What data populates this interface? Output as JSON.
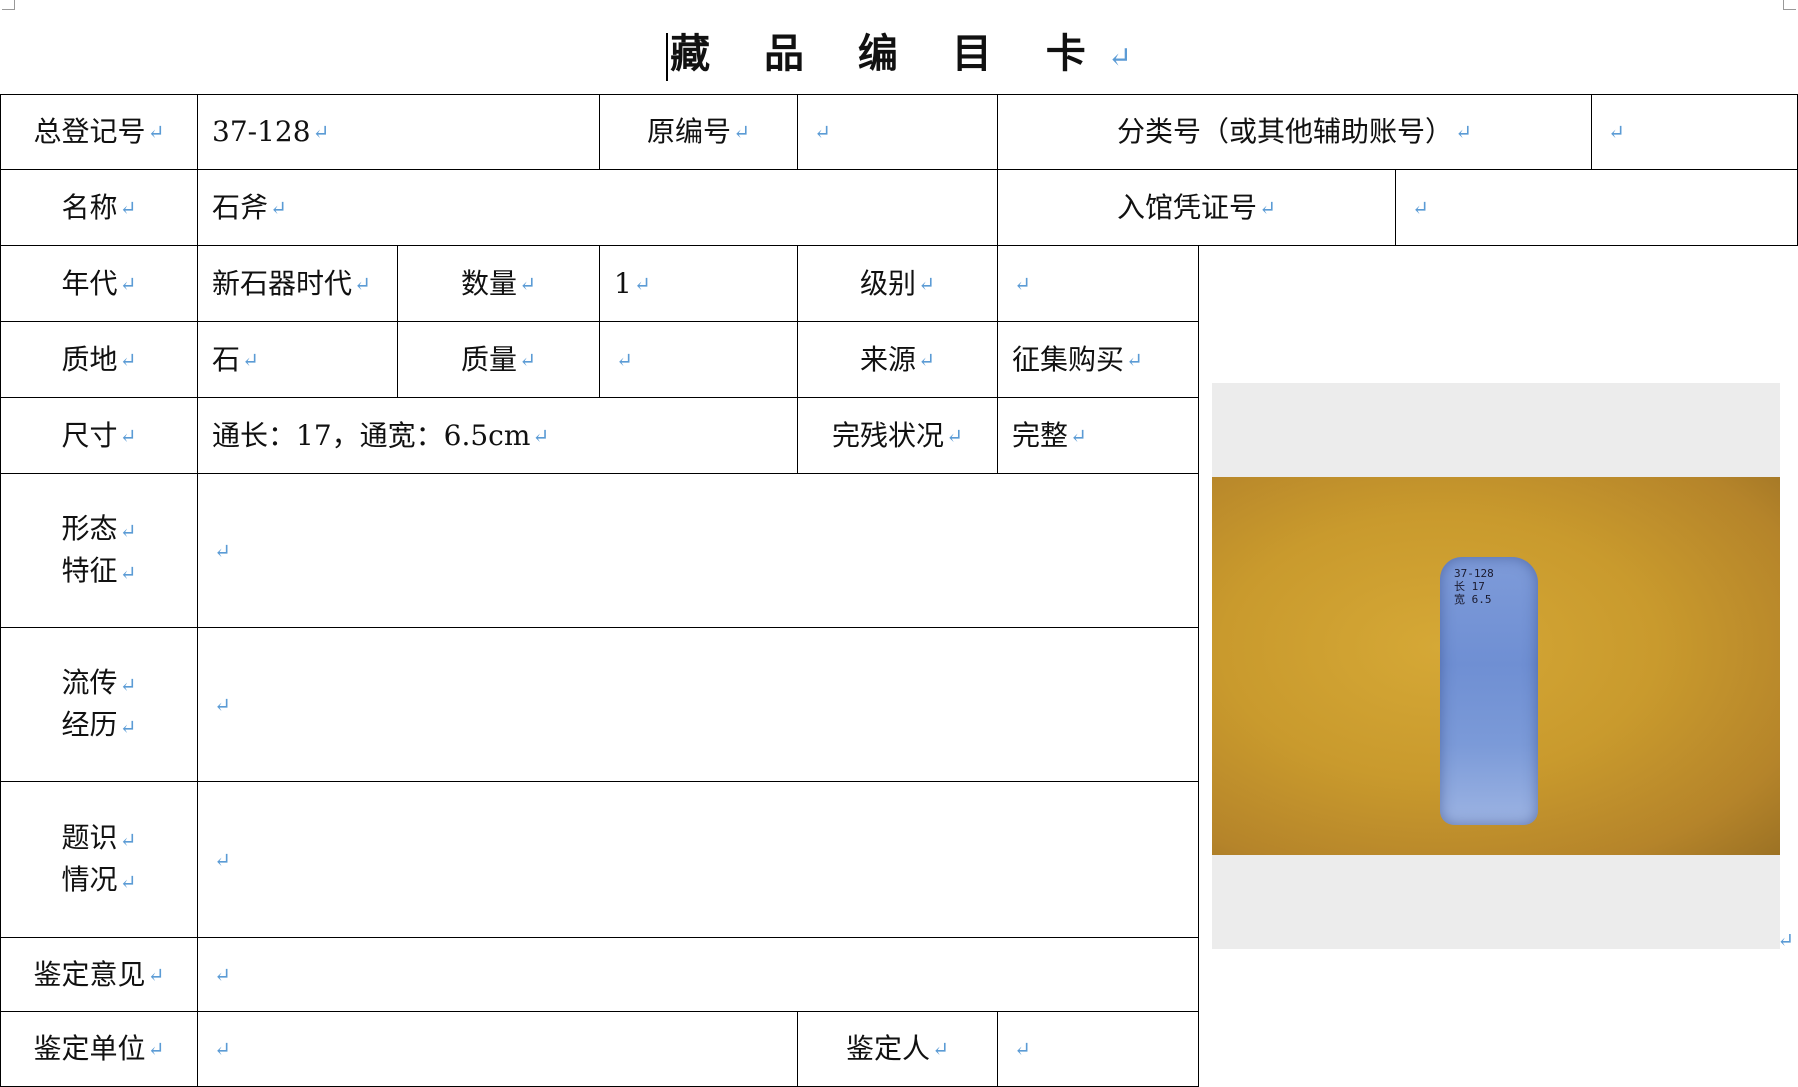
{
  "title": "藏 品 编 目 卡",
  "return_mark": "↵",
  "row1": {
    "label1": "总登记号",
    "value1": "37-128",
    "label2": "原编号",
    "value2": "",
    "label3": "分类号（或其他辅助账号）",
    "value3": ""
  },
  "row2": {
    "label1": "名称",
    "value1": "石斧",
    "label2": "入馆凭证号",
    "value2": ""
  },
  "row3": {
    "label1": "年代",
    "value1": "新石器时代",
    "label2": "数量",
    "value2": "1",
    "label3": "级别",
    "value3": ""
  },
  "row4": {
    "label1": "质地",
    "value1": "石",
    "label2": "质量",
    "value2": "",
    "label3": "来源",
    "value3": "征集购买"
  },
  "row5": {
    "label1": "尺寸",
    "value1": "通长：17，通宽：6.5cm",
    "label2": "完残状况",
    "value2": "完整"
  },
  "row6": {
    "label_line1": "形态",
    "label_line2": "特征",
    "value": ""
  },
  "row7": {
    "label_line1": "流传",
    "label_line2": "经历",
    "value": ""
  },
  "row8": {
    "label_line1": "题识",
    "label_line2": "情况",
    "value": ""
  },
  "row9": {
    "label": "鉴定意见",
    "value": ""
  },
  "row10": {
    "label1": "鉴定单位",
    "value1": "",
    "label2": "鉴定人",
    "value2": ""
  },
  "photo": {
    "label_line1": "37-128",
    "label_line2": "长 17",
    "label_line3": "宽 6.5"
  }
}
